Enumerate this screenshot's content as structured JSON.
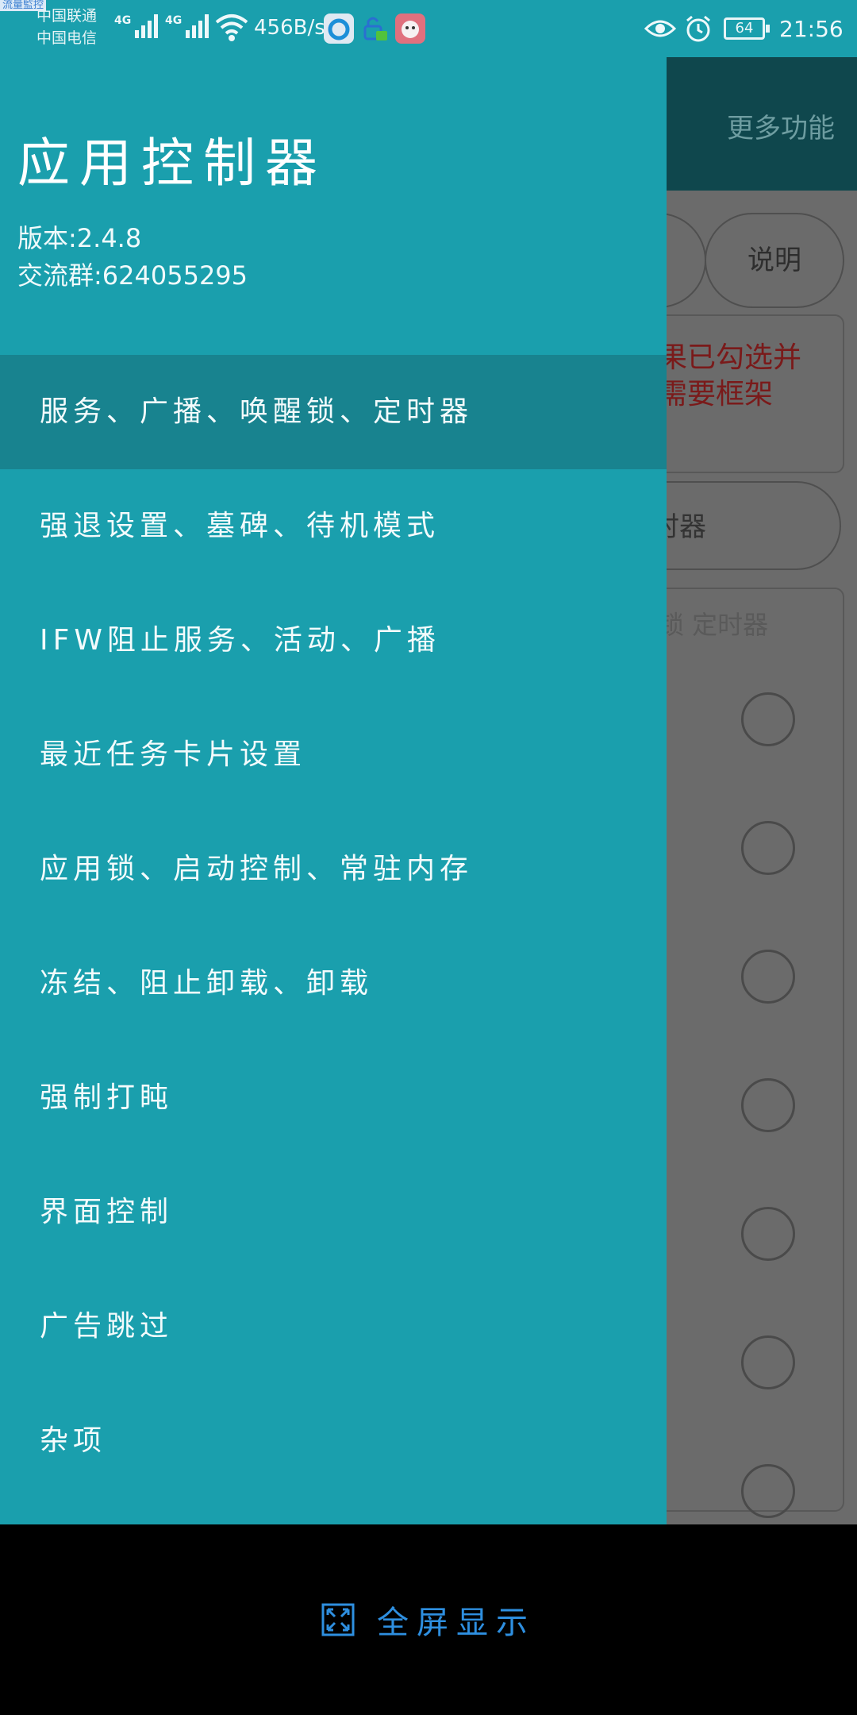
{
  "status_bar": {
    "corner_label": "流量監控",
    "carrier1": "中国联通",
    "carrier2": "中国电信",
    "sim1_network": "4G",
    "sim2_network": "4G",
    "net_speed": "456B/s",
    "battery": "64",
    "time": "21:56"
  },
  "drawer": {
    "title": "应用控制器",
    "version": "版本:2.4.8",
    "group": "交流群:624055295",
    "items": [
      {
        "label": "服务、广播、唤醒锁、定时器"
      },
      {
        "label": "强退设置、墓碑、待机模式"
      },
      {
        "label": "IFW阻止服务、活动、广播"
      },
      {
        "label": "最近任务卡片设置"
      },
      {
        "label": "应用锁、启动控制、常驻内存"
      },
      {
        "label": "冻结、阻止卸载、卸载"
      },
      {
        "label": "强制打盹"
      },
      {
        "label": "界面控制"
      },
      {
        "label": "广告跳过"
      },
      {
        "label": "杂项"
      }
    ]
  },
  "background": {
    "more_label": "更多功能",
    "help_label": "说明",
    "warning_line1": "果已勾选并",
    "warning_line2": "需要框架",
    "timer_label": "时器",
    "panel_title": "锁 定时器"
  },
  "bottom": {
    "fullscreen_label": "全屏显示"
  }
}
